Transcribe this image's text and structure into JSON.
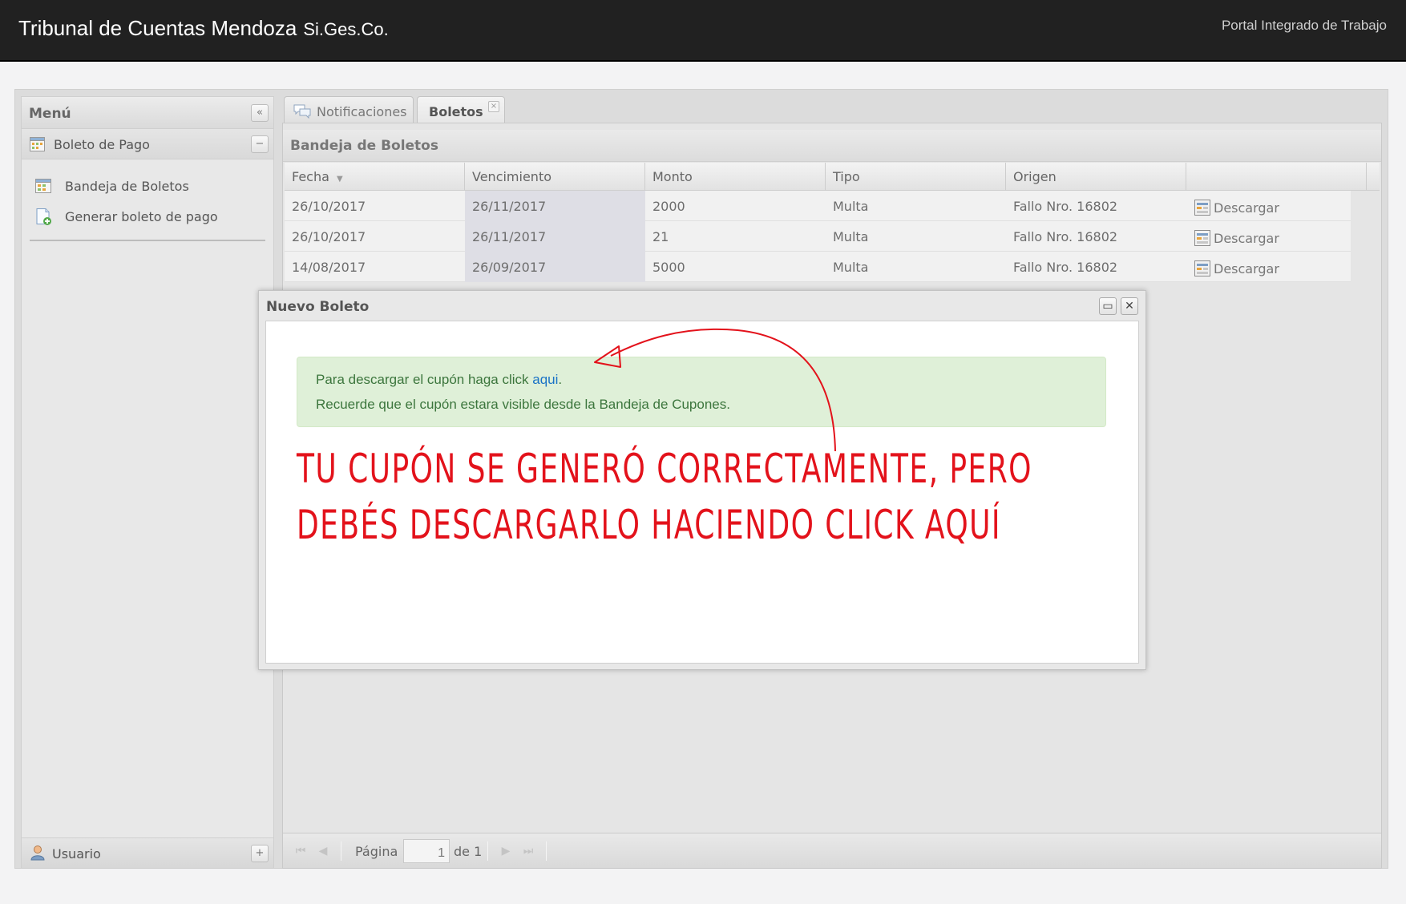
{
  "header": {
    "title": "Tribunal de Cuentas Mendoza",
    "subtitle": "Si.Ges.Co.",
    "portal_link": "Portal Integrado de Trabajo"
  },
  "menu": {
    "title": "Menú",
    "section": "Boleto de Pago",
    "items": [
      {
        "label": "Bandeja de Boletos",
        "icon": "inbox-grid-icon"
      },
      {
        "label": "Generar boleto de pago",
        "icon": "new-document-icon"
      }
    ],
    "footer": "Usuario"
  },
  "tabs": [
    {
      "label": "Notificaciones",
      "icon": "speech-bubbles-icon",
      "active": false
    },
    {
      "label": "Boletos",
      "active": true,
      "closable": true
    }
  ],
  "grid": {
    "title": "Bandeja de Boletos",
    "columns": [
      "Fecha",
      "Vencimiento",
      "Monto",
      "Tipo",
      "Origen",
      ""
    ],
    "sort_column": "Fecha",
    "rows": [
      {
        "fecha": "26/10/2017",
        "vencimiento": "26/11/2017",
        "monto": "2000",
        "tipo": "Multa",
        "origen": "Fallo Nro. 16802",
        "action": "Descargar"
      },
      {
        "fecha": "26/10/2017",
        "vencimiento": "26/11/2017",
        "monto": "21",
        "tipo": "Multa",
        "origen": "Fallo Nro. 16802",
        "action": "Descargar"
      },
      {
        "fecha": "14/08/2017",
        "vencimiento": "26/09/2017",
        "monto": "5000",
        "tipo": "Multa",
        "origen": "Fallo Nro. 16802",
        "action": "Descargar"
      }
    ]
  },
  "pager": {
    "page_label": "Página",
    "page_value": "1",
    "of_label": "de 1"
  },
  "modal": {
    "title": "Nuevo Boleto",
    "alert_line1_prefix": "Para descargar el cupón haga click ",
    "alert_link": "aqui",
    "alert_line1_suffix": ".",
    "alert_line2": "Recuerde que el cupón estara visible desde la Bandeja de Cupones."
  },
  "annotation": {
    "line1": "TU CUPÓN SE GENERÓ CORRECTAMENTE, PERO",
    "line2": "DEBÉS DESCARGARLO HACIENDO CLICK AQUÍ",
    "color": "#e3121b"
  },
  "colors": {
    "header_bg": "#212121",
    "alert_bg": "#dff0d8",
    "alert_text": "#3c763d",
    "link": "#1a73c6"
  }
}
